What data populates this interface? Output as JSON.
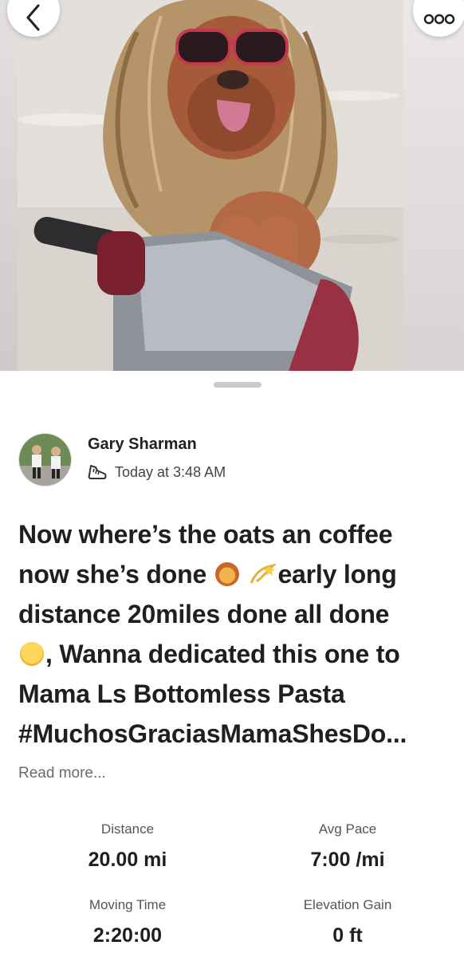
{
  "nav": {
    "back_icon": "chevron-left-icon",
    "more_icon": "more-horizontal-icon"
  },
  "photo": {
    "subject": "dog-wearing-lion-mane-and-sunglasses-on-scooter"
  },
  "post": {
    "author_name": "Gary Sharman",
    "activity_icon": "running-shoe-icon",
    "timestamp": "Today at 3:48 AM",
    "title_lines": [
      "Now where’s the oats an coffee",
      "now she’s done",
      "early long",
      "distance 20miles done all done",
      ", Wanna dedicated this one to",
      "Mama Ls Bottomless Pasta",
      "#MuchosGraciasMamaShesDo..."
    ],
    "emoji_icons": [
      "lion-face-emoji",
      "dizzy-emoji",
      "zany-face-emoji"
    ],
    "read_more": "Read more..."
  },
  "stats": {
    "distance": {
      "label": "Distance",
      "value": "20.00 mi"
    },
    "avg_pace": {
      "label": "Avg Pace",
      "value": "7:00 /mi"
    },
    "moving_time": {
      "label": "Moving Time",
      "value": "2:20:00"
    },
    "elevation_gain": {
      "label": "Elevation Gain",
      "value": "0 ft"
    }
  },
  "colors": {
    "text_primary": "#1f1f1f",
    "text_secondary": "#6b6b6b",
    "grabber": "#c9c9c9"
  }
}
